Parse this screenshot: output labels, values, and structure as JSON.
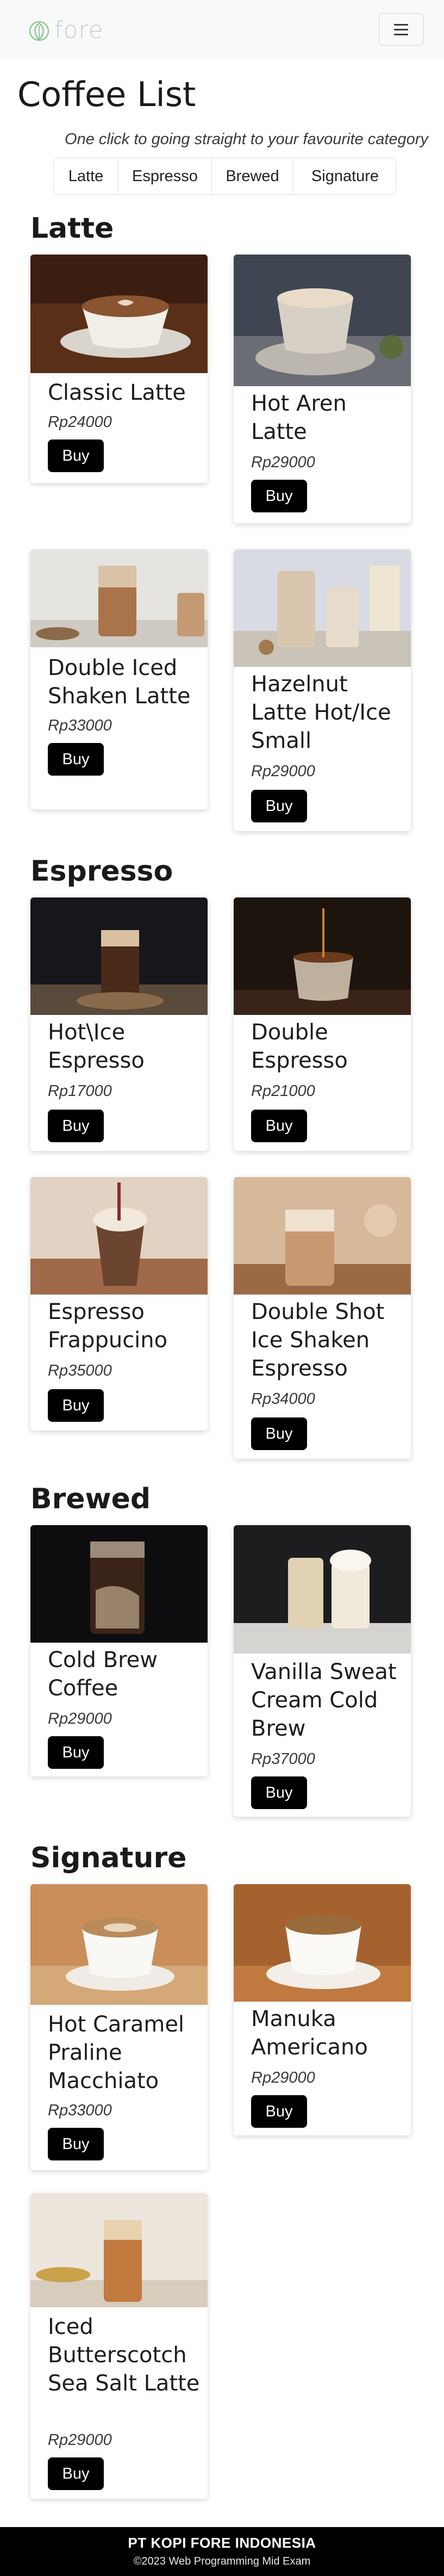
{
  "navbar": {
    "brand_text": "fore",
    "logo_icon": "leaf-circle-icon",
    "toggler_icon": "hamburger-menu-icon"
  },
  "header": {
    "title": "Coffee List",
    "tagline": "One click to going straight to your favourite category",
    "categories": [
      "Latte",
      "Espresso",
      "Brewed",
      "Signature"
    ]
  },
  "sections": [
    {
      "title": "Latte",
      "items": [
        {
          "name": "Classic Latte",
          "price": "Rp24000",
          "buy": "Buy"
        },
        {
          "name": "Hot Aren Latte",
          "price": "Rp29000",
          "buy": "Buy"
        },
        {
          "name": "Double Iced Shaken Latte",
          "price": "Rp33000",
          "buy": "Buy"
        },
        {
          "name": "Hazelnut Latte Hot/Ice Small",
          "price": "Rp29000",
          "buy": "Buy"
        }
      ]
    },
    {
      "title": "Espresso",
      "items": [
        {
          "name": "Hot\\Ice Espresso",
          "price": "Rp17000",
          "buy": "Buy"
        },
        {
          "name": "Double Espresso",
          "price": "Rp21000",
          "buy": "Buy"
        },
        {
          "name": "Espresso Frappucino",
          "price": "Rp35000",
          "buy": "Buy"
        },
        {
          "name": "Double Shot Ice Shaken Espresso",
          "price": "Rp34000",
          "buy": "Buy"
        }
      ]
    },
    {
      "title": "Brewed",
      "items": [
        {
          "name": "Cold Brew Coffee",
          "price": "Rp29000",
          "buy": "Buy"
        },
        {
          "name": "Vanilla Sweat Cream Cold Brew",
          "price": "Rp37000",
          "buy": "Buy"
        }
      ]
    },
    {
      "title": "Signature",
      "items": [
        {
          "name": "Hot Caramel Praline Macchiato",
          "price": "Rp33000",
          "buy": "Buy"
        },
        {
          "name": "Manuka Americano",
          "price": "Rp29000",
          "buy": "Buy"
        },
        {
          "name": "Iced Butterscotch Sea Salt Latte",
          "price": "Rp29000",
          "buy": "Buy"
        }
      ]
    }
  ],
  "footer": {
    "company": "PT KOPI FORE INDONESIA",
    "copyright": "©2023 Web Programming Mid Exam"
  },
  "colors": {
    "navbar_bg": "#f8f9fa",
    "logo_green": "#8fc98f",
    "button_bg": "#000000",
    "footer_bg": "#000000"
  }
}
